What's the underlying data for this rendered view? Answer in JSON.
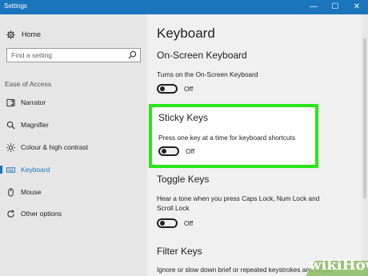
{
  "window": {
    "title": "Settings",
    "minimize": "—",
    "maximize": "☐",
    "close": "✕"
  },
  "sidebar": {
    "home_label": "Home",
    "search_placeholder": "Find a setting",
    "group_label": "Ease of Access",
    "items": [
      {
        "label": "Narrator",
        "icon": "narrator-icon"
      },
      {
        "label": "Magnifier",
        "icon": "magnifier-icon"
      },
      {
        "label": "Colour & high contrast",
        "icon": "brightness-icon"
      },
      {
        "label": "Keyboard",
        "icon": "keyboard-icon",
        "active": true
      },
      {
        "label": "Mouse",
        "icon": "mouse-icon"
      },
      {
        "label": "Other options",
        "icon": "refresh-icon"
      }
    ]
  },
  "main": {
    "page_title": "Keyboard",
    "onscreen": {
      "title": "On-Screen Keyboard",
      "desc": "Turns on the On-Screen Keyboard",
      "state": "Off"
    },
    "sticky": {
      "title": "Sticky Keys",
      "desc": "Press one key at a time for keyboard shortcuts",
      "state": "Off"
    },
    "toggle": {
      "title": "Toggle Keys",
      "desc": "Hear a tone when you press Caps Lock, Num Lock and Scroll Lock",
      "state": "Off"
    },
    "filter": {
      "title": "Filter Keys",
      "desc": "Ignore or slow down brief or repeated keystrokes and adjust"
    }
  },
  "colors": {
    "accent": "#1a75bd",
    "highlight": "#2ae51a"
  },
  "watermark": {
    "text": "wikiHow"
  }
}
